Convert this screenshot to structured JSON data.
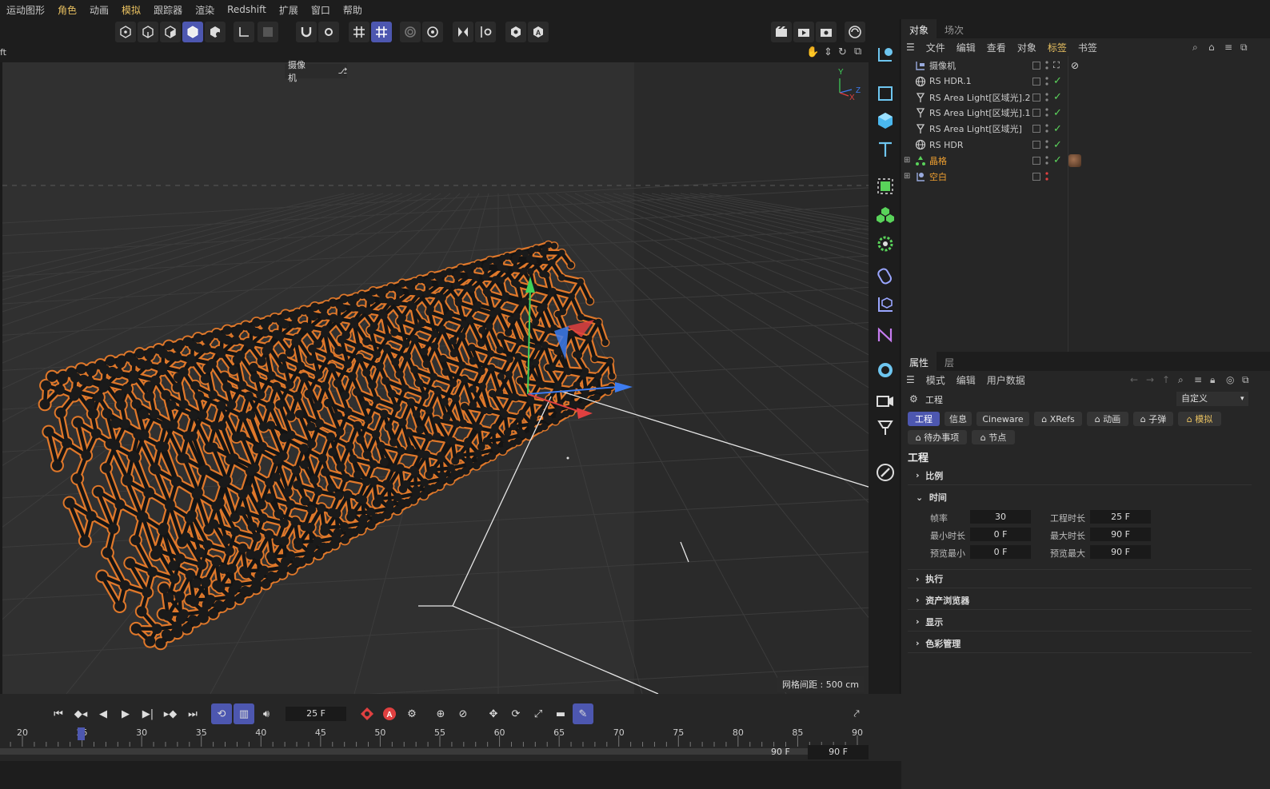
{
  "menubar": {
    "items": [
      "运动图形",
      "角色",
      "动画",
      "模拟",
      "跟踪器",
      "渲染",
      "Redshift",
      "扩展",
      "窗口",
      "帮助"
    ]
  },
  "viewport": {
    "left_label": "ft",
    "camera_label": "摄像机",
    "grid_spacing": "网格间距 : 500 cm",
    "axis_y": "Y",
    "axis_x": "X",
    "axis_z": "Z"
  },
  "object_manager": {
    "tabs": [
      "对象",
      "场次"
    ],
    "menu": [
      "文件",
      "编辑",
      "查看",
      "对象",
      "标签",
      "书签"
    ],
    "objects": [
      {
        "name": "摄像机",
        "icon": "camera-icon",
        "highlight": false
      },
      {
        "name": "RS HDR.1",
        "icon": "globe-icon",
        "highlight": false
      },
      {
        "name": "RS Area Light[区域光].2",
        "icon": "light-icon",
        "highlight": false
      },
      {
        "name": "RS Area Light[区域光].1",
        "icon": "light-icon",
        "highlight": false
      },
      {
        "name": "RS Area Light[区域光]",
        "icon": "light-icon",
        "highlight": false
      },
      {
        "name": "RS HDR",
        "icon": "globe-icon",
        "highlight": false
      },
      {
        "name": "晶格",
        "icon": "lattice-icon",
        "highlight": true
      },
      {
        "name": "空白",
        "icon": "null-icon",
        "highlight": true
      }
    ]
  },
  "attributes": {
    "tabs": [
      "属性",
      "层"
    ],
    "menu": [
      "模式",
      "编辑",
      "用户数据"
    ],
    "object_title": "工程",
    "preset": "自定义",
    "pills_row1": [
      "工程",
      "信息",
      "Cineware",
      "XRefs",
      "动画",
      "子弹",
      "模拟"
    ],
    "pills_row2": [
      "待办事项",
      "节点"
    ],
    "section_title": "工程",
    "sections": [
      "比例",
      "时间",
      "执行",
      "资产浏览器",
      "显示",
      "色彩管理"
    ],
    "time": {
      "fps_label": "帧率",
      "fps": "30",
      "project_len_label": "工程时长",
      "project_len": "25 F",
      "min_label": "最小时长",
      "min": "0 F",
      "max_label": "最大时长",
      "max": "90 F",
      "pmin_label": "预览最小",
      "pmin": "0 F",
      "pmax_label": "预览最大",
      "pmax": "90 F"
    }
  },
  "timeline": {
    "current_frame": "25 F",
    "ticks": [
      "20",
      "25",
      "30",
      "35",
      "40",
      "45",
      "50",
      "55",
      "60",
      "65",
      "70",
      "75",
      "80",
      "85",
      "90"
    ],
    "end_frame_a": "90 F",
    "end_frame_b": "90 F"
  },
  "colors": {
    "accent": "#4d57b0",
    "orange": "#e07a20",
    "check": "#5bd35b"
  }
}
